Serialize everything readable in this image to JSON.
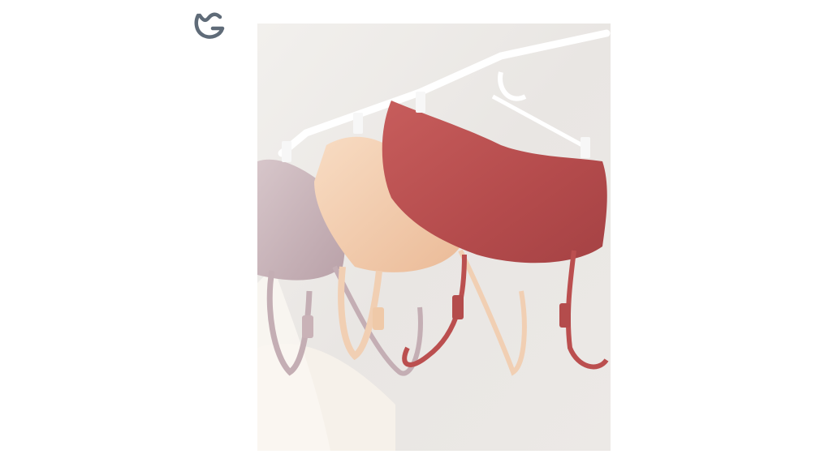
{
  "logo": {
    "icon": "mg-monogram-icon",
    "color": "#5f6b78"
  },
  "photo": {
    "subject": "product-photo",
    "items": [
      {
        "name": "mauve-bra",
        "color": "#cdb8bd"
      },
      {
        "name": "peach-bra",
        "color": "#f3d0b3"
      },
      {
        "name": "rose-red-bra",
        "color": "#bb4f4f"
      }
    ],
    "background_color": "#ebe8e5"
  }
}
